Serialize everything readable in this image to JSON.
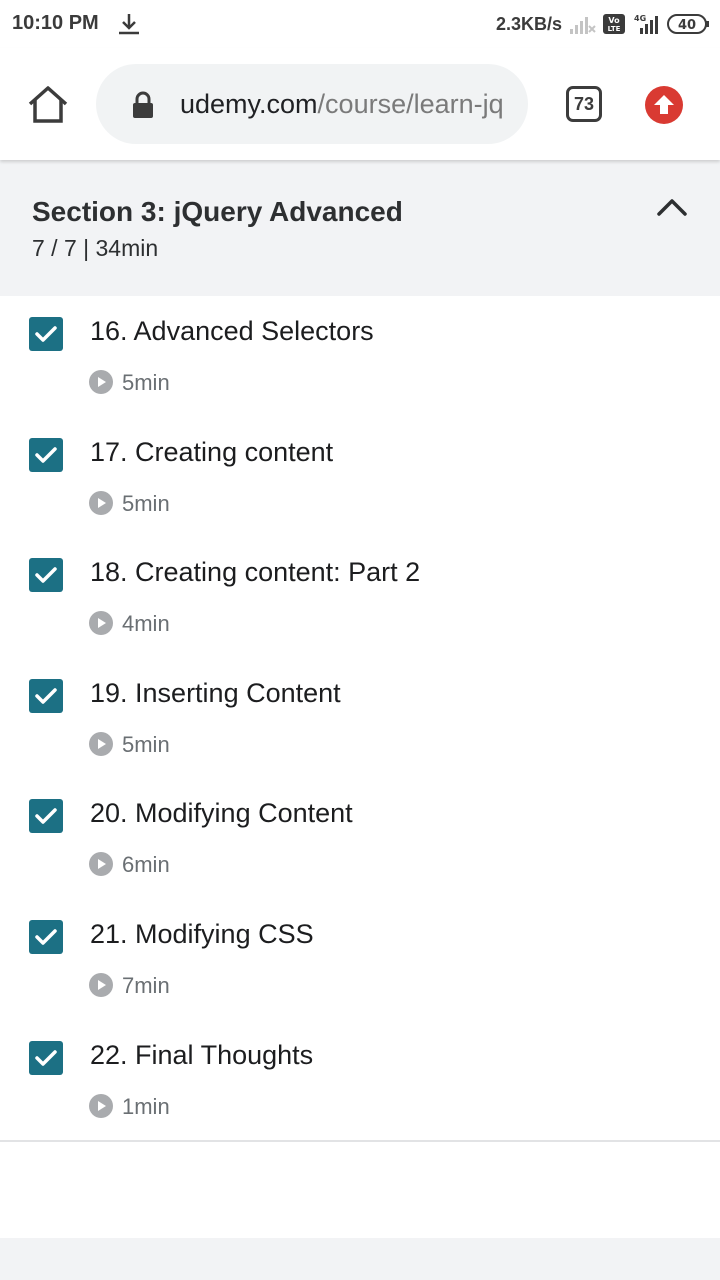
{
  "status_bar": {
    "time": "10:10 PM",
    "net_speed": "2.3KB/s",
    "network_type": "4G",
    "battery": "40",
    "icons": [
      "download-icon",
      "signal-icon",
      "volte-icon",
      "battery-icon"
    ]
  },
  "browser": {
    "url_domain": "udemy.com",
    "url_path": "/course/learn-jq",
    "tab_count": "73",
    "accent_color": "#d93a32"
  },
  "section": {
    "title": "Section 3: jQuery Advanced",
    "meta": "7 / 7 | 34min"
  },
  "lectures": [
    {
      "title": "16. Advanced Selectors",
      "duration": "5min",
      "completed": true
    },
    {
      "title": "17. Creating content",
      "duration": "5min",
      "completed": true
    },
    {
      "title": "18. Creating content: Part 2",
      "duration": "4min",
      "completed": true
    },
    {
      "title": "19. Inserting Content",
      "duration": "5min",
      "completed": true
    },
    {
      "title": "20. Modifying Content",
      "duration": "6min",
      "completed": true
    },
    {
      "title": "21. Modifying CSS",
      "duration": "7min",
      "completed": true
    },
    {
      "title": "22. Final Thoughts",
      "duration": "1min",
      "completed": true
    }
  ],
  "colors": {
    "checkbox": "#1c7084",
    "section_bg": "#f2f3f5"
  }
}
